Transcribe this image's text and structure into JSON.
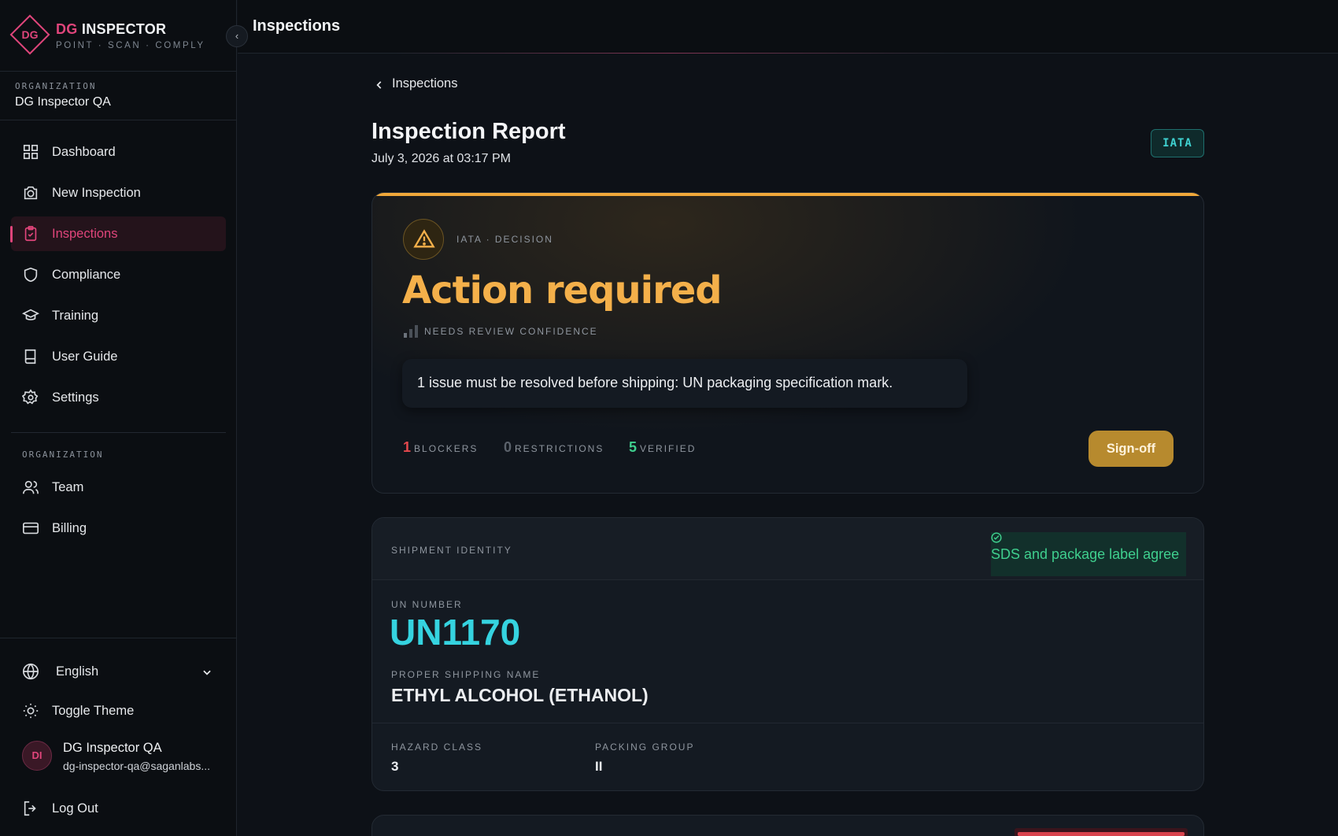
{
  "app": {
    "logo_mark": "DG",
    "name_prefix": "DG",
    "name_suffix": "INSPECTOR",
    "tagline": "POINT · SCAN · COMPLY"
  },
  "organization": {
    "label": "ORGANIZATION",
    "name": "DG Inspector QA"
  },
  "nav": {
    "items": [
      {
        "label": "Dashboard",
        "icon": "grid-icon"
      },
      {
        "label": "New Inspection",
        "icon": "camera-icon"
      },
      {
        "label": "Inspections",
        "icon": "clipboard-check-icon",
        "active": true
      },
      {
        "label": "Compliance",
        "icon": "shield-icon"
      },
      {
        "label": "Training",
        "icon": "graduation-cap-icon"
      },
      {
        "label": "User Guide",
        "icon": "book-icon"
      },
      {
        "label": "Settings",
        "icon": "gear-icon"
      }
    ],
    "org_section_label": "ORGANIZATION",
    "org_items": [
      {
        "label": "Team",
        "icon": "users-icon"
      },
      {
        "label": "Billing",
        "icon": "credit-card-icon"
      }
    ]
  },
  "footer": {
    "language": "English",
    "toggle_theme": "Toggle Theme",
    "user_initials": "DI",
    "user_name": "DG Inspector QA",
    "user_email": "dg-inspector-qa@saganlabs...",
    "logout": "Log Out"
  },
  "topbar": {
    "title": "Inspections"
  },
  "report": {
    "breadcrumb": "Inspections",
    "title": "Inspection Report",
    "date": "July 3, 2026 at 03:17 PM",
    "regulation_badge": "IATA"
  },
  "decision": {
    "label": "IATA · DECISION",
    "title": "Action required",
    "confidence": "NEEDS REVIEW CONFIDENCE",
    "issue": "1 issue must be resolved before shipping: UN packaging specification mark.",
    "blockers_count": "1",
    "blockers_label": "BLOCKERS",
    "restrictions_count": "0",
    "restrictions_label": "RESTRICTIONS",
    "verified_count": "5",
    "verified_label": "VERIFIED",
    "signoff_label": "Sign-off",
    "colors": {
      "warning": "#f4b04a",
      "blocker": "#e5484d",
      "verified": "#3fcf8e"
    }
  },
  "identity": {
    "label": "SHIPMENT IDENTITY",
    "agreement": "SDS and package label agree",
    "un_label": "UN NUMBER",
    "un_number": "UN1170",
    "psn_label": "PROPER SHIPPING NAME",
    "psn": "ETHYL ALCOHOL (ETHANOL)",
    "hazard_label": "HAZARD CLASS",
    "hazard_class": "3",
    "packing_label": "PACKING GROUP",
    "packing_group": "II"
  }
}
